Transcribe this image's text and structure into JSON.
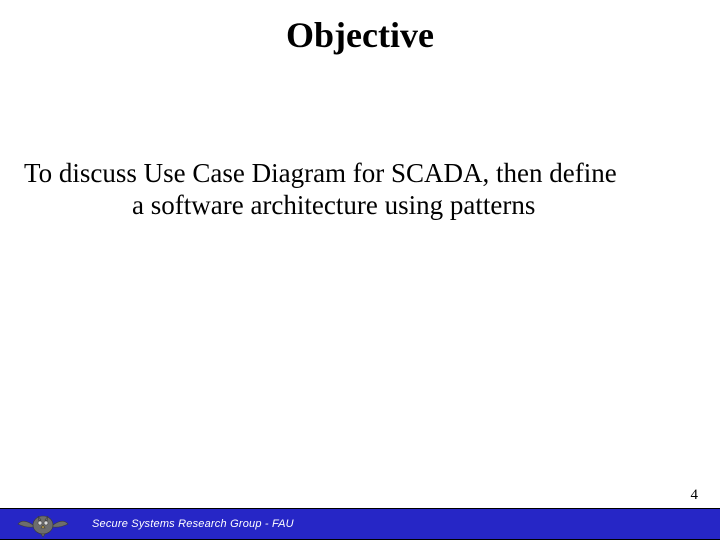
{
  "slide": {
    "title": "Objective",
    "body_line1": "To discuss Use Case Diagram for SCADA, then define",
    "body_line2": "a software architecture using patterns",
    "page_number": "4"
  },
  "footer": {
    "logo_name": "owl-logo",
    "text": "Secure Systems Research Group - FAU"
  }
}
